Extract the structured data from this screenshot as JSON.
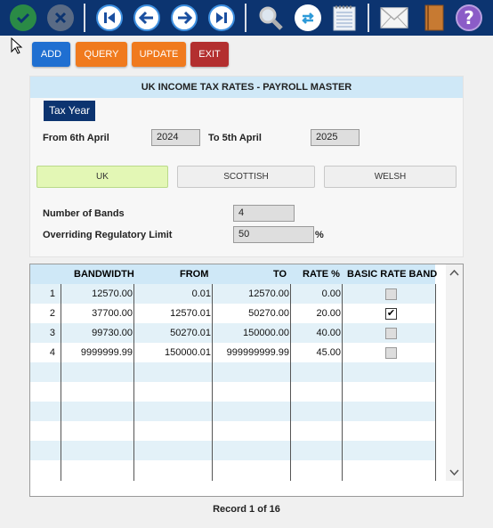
{
  "toolbar": {
    "icons": [
      "confirm-icon",
      "cancel-icon",
      "first-record-icon",
      "previous-record-icon",
      "next-record-icon",
      "last-record-icon",
      "search-icon",
      "refresh-icon",
      "notepad-icon",
      "email-icon",
      "book-icon",
      "help-icon"
    ]
  },
  "actions": {
    "add": "ADD",
    "query": "QUERY",
    "update": "UPDATE",
    "exit": "EXIT"
  },
  "form": {
    "title": "UK INCOME TAX RATES - PAYROLL MASTER",
    "tax_year_label": "Tax Year",
    "from_label": "From 6th April",
    "from_value": "2024",
    "to_label": "To 5th April",
    "to_value": "2025",
    "regions": [
      {
        "label": "UK",
        "selected": true
      },
      {
        "label": "SCOTTISH",
        "selected": false
      },
      {
        "label": "WELSH",
        "selected": false
      }
    ],
    "bands_label": "Number of Bands",
    "bands_value": "4",
    "limit_label": "Overriding Regulatory Limit",
    "limit_value": "50",
    "limit_unit": "%"
  },
  "grid": {
    "headers": [
      "",
      "BANDWIDTH",
      "FROM",
      "TO",
      "RATE %",
      "BASIC RATE BAND"
    ],
    "rows": [
      {
        "no": "1",
        "bandwidth": "12570.00",
        "from": "0.01",
        "to": "12570.00",
        "rate": "0.00",
        "basic": false
      },
      {
        "no": "2",
        "bandwidth": "37700.00",
        "from": "12570.01",
        "to": "50270.00",
        "rate": "20.00",
        "basic": true
      },
      {
        "no": "3",
        "bandwidth": "99730.00",
        "from": "50270.01",
        "to": "150000.00",
        "rate": "40.00",
        "basic": false
      },
      {
        "no": "4",
        "bandwidth": "9999999.99",
        "from": "150000.01",
        "to": "999999999.99",
        "rate": "45.00",
        "basic": false
      }
    ],
    "empty_rows": 6
  },
  "status": {
    "record": "Record 1 of 16"
  },
  "colors": {
    "toolbar_bg": "#0c3470",
    "add": "#1f6fd1",
    "query": "#f07a1e",
    "update": "#f07a1e",
    "exit": "#b32f2f",
    "uk_selected": "#e3f7b5",
    "row_alt": "#e3f1f8",
    "header_bg": "#cfe8f7"
  }
}
